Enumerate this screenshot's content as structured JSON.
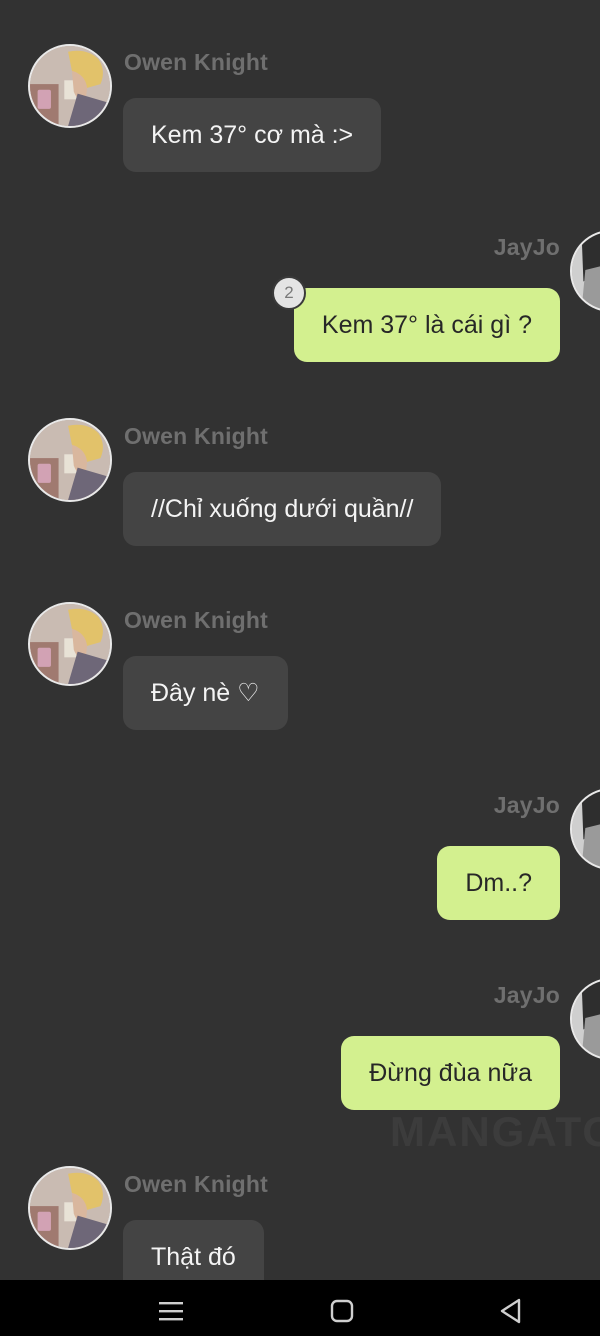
{
  "messages": [
    {
      "id": 1,
      "side": "left",
      "sender": "Owen Knight",
      "text": "Kem 37° cơ mà :>"
    },
    {
      "id": 2,
      "side": "right",
      "sender": "JayJo",
      "text": "Kem 37° là cái gì ?",
      "badge": "2"
    },
    {
      "id": 3,
      "side": "left",
      "sender": "Owen Knight",
      "text": "//Chỉ xuống dưới quần//"
    },
    {
      "id": 4,
      "side": "left",
      "sender": "Owen Knight",
      "text": "Đây nè ♡"
    },
    {
      "id": 5,
      "side": "right",
      "sender": "JayJo",
      "text": "Dm..?"
    },
    {
      "id": 6,
      "side": "right",
      "sender": "JayJo",
      "text": "Đừng đùa nữa"
    },
    {
      "id": 7,
      "side": "left",
      "sender": "Owen Knight",
      "text": "Thật đó"
    }
  ],
  "watermark": "MANGATOO",
  "navbar": {
    "items": [
      "menu-icon",
      "home-icon",
      "back-icon"
    ]
  },
  "colors": {
    "background": "#323232",
    "incoming_bubble": "#444444",
    "outgoing_bubble": "#d3f08f",
    "sender_name": "#6f6f6f",
    "navbar": "#000000"
  }
}
